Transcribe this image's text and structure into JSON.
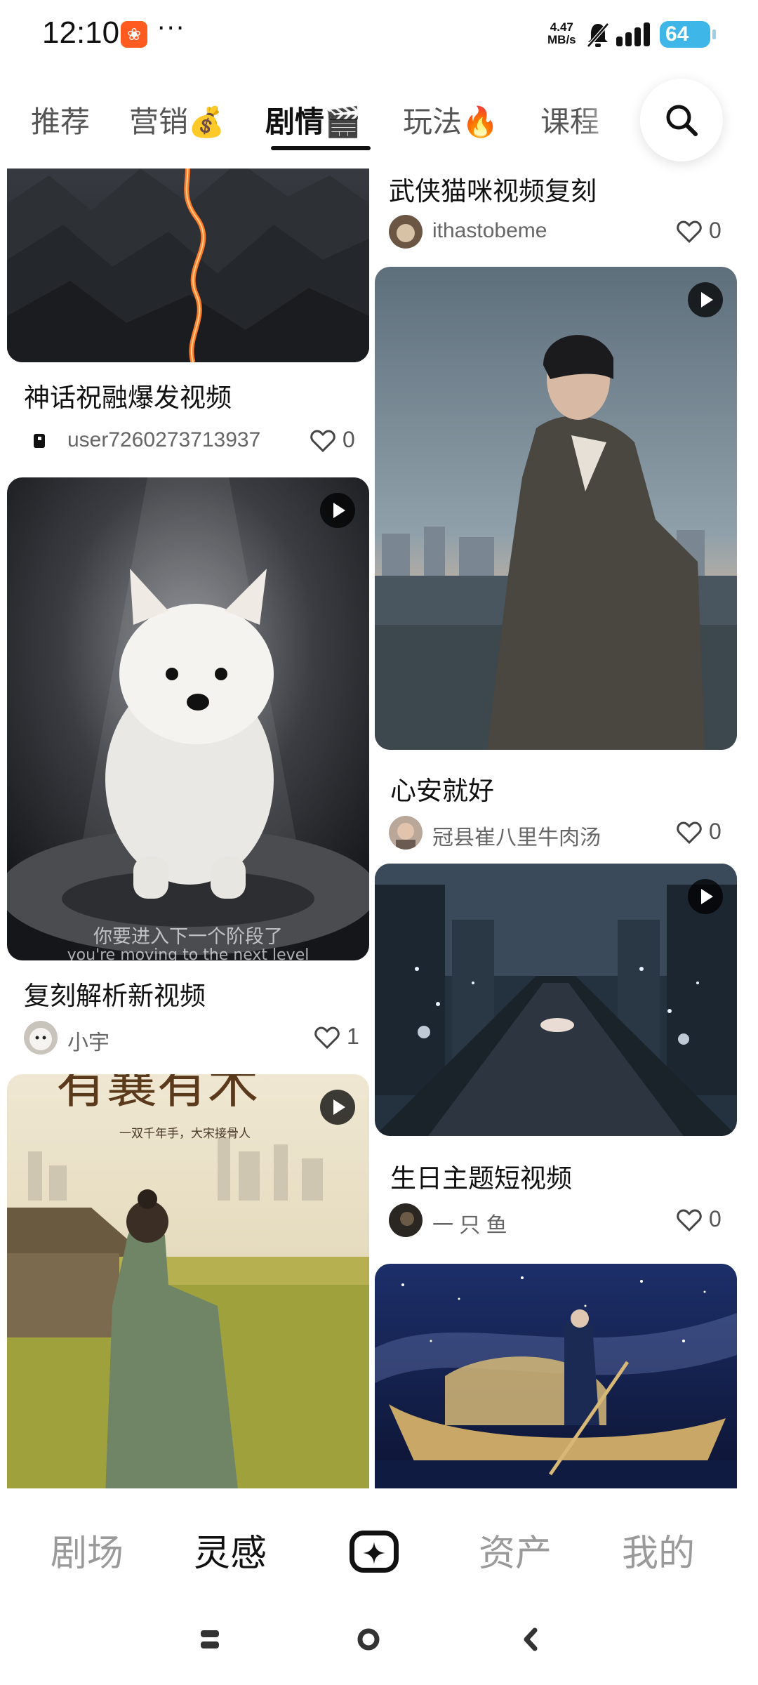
{
  "status_bar": {
    "time": "12:10",
    "app_icon": "app-notification-icon",
    "more_dots": "···",
    "speed_value": "4.47",
    "speed_unit": "MB/s",
    "battery": "64"
  },
  "tabs": [
    {
      "label": "推荐",
      "active": false
    },
    {
      "label": "营销💰",
      "active": false
    },
    {
      "label": "剧情🎬",
      "active": true
    },
    {
      "label": "玩法🔥",
      "active": false
    },
    {
      "label": "课程",
      "active": false
    }
  ],
  "feed": {
    "left": [
      {
        "title": "神话祝融爆发视频",
        "author": "user7260273713937",
        "likes": "0",
        "video": false
      },
      {
        "title": "复刻解析新视频",
        "author": "小宇",
        "likes": "1",
        "video": true,
        "subtitle_cn": "你要进入下一个阶段了",
        "subtitle_en": "you're moving to the next level"
      },
      {
        "title": "",
        "author": "",
        "likes": "",
        "video": true,
        "poster_title": "有襄有木",
        "poster_sub": "一双千年手，大宋接骨人"
      }
    ],
    "right": [
      {
        "title": "武侠猫咪视频复刻",
        "author": "ithastobeme",
        "likes": "0",
        "video": false
      },
      {
        "title": "心安就好",
        "author": "冠县崔八里牛肉汤",
        "likes": "0",
        "video": true
      },
      {
        "title": "生日主题短视频",
        "author": "一 只  鱼",
        "likes": "0",
        "video": true
      },
      {
        "title": "",
        "author": "",
        "likes": "",
        "video": false
      }
    ]
  },
  "bottom_nav": [
    {
      "label": "剧场",
      "active": false
    },
    {
      "label": "灵感",
      "active": true
    },
    {
      "label": "create",
      "active": false
    },
    {
      "label": "资产",
      "active": false
    },
    {
      "label": "我的",
      "active": false
    }
  ],
  "colors": {
    "accent": "#111111",
    "battery": "#3fb6e8",
    "app_badge": "#ff5a1f"
  }
}
